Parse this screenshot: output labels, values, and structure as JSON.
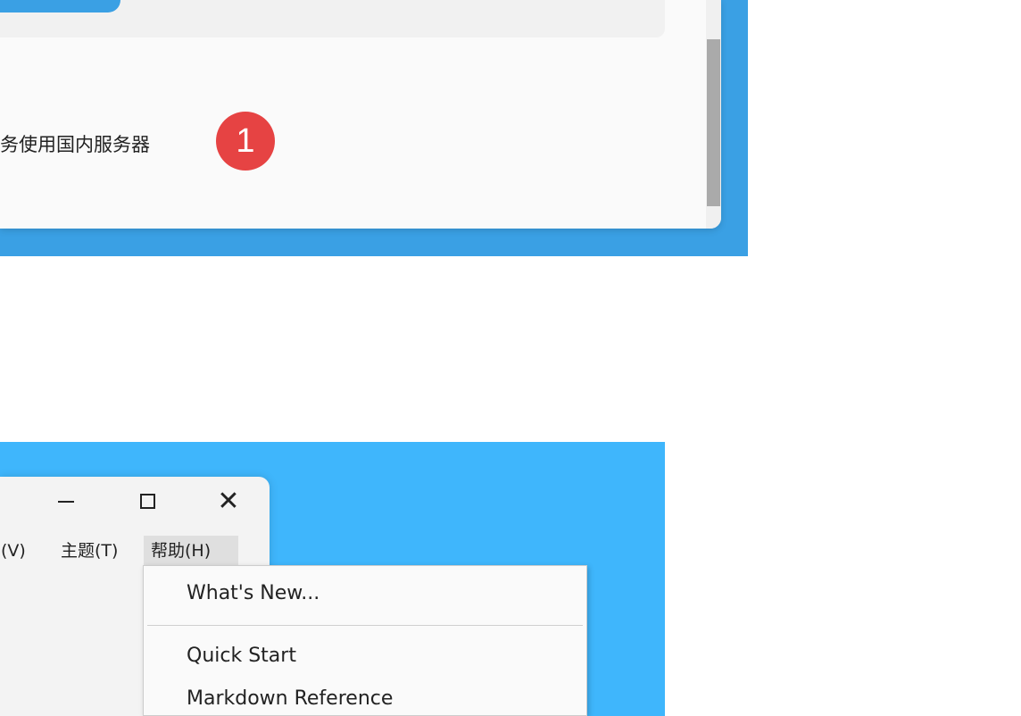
{
  "top_section": {
    "row_label": "务使用国内服务器",
    "badge_number": "1"
  },
  "ghost_text": [],
  "editor_window": {
    "controls": {
      "minimize": "—",
      "maximize": "☐",
      "close": "✕"
    },
    "menu_bar": {
      "view_label": "图(V)",
      "theme_label": "主题(T)",
      "help_label": "帮助(H)"
    },
    "help_menu": {
      "items": [
        "What's New...",
        "Quick Start",
        "Markdown Reference"
      ]
    }
  },
  "colors": {
    "accent_blue_top": "#3aa0e4",
    "accent_blue_bottom": "#3fb6fc",
    "badge_red": "#e64343"
  }
}
